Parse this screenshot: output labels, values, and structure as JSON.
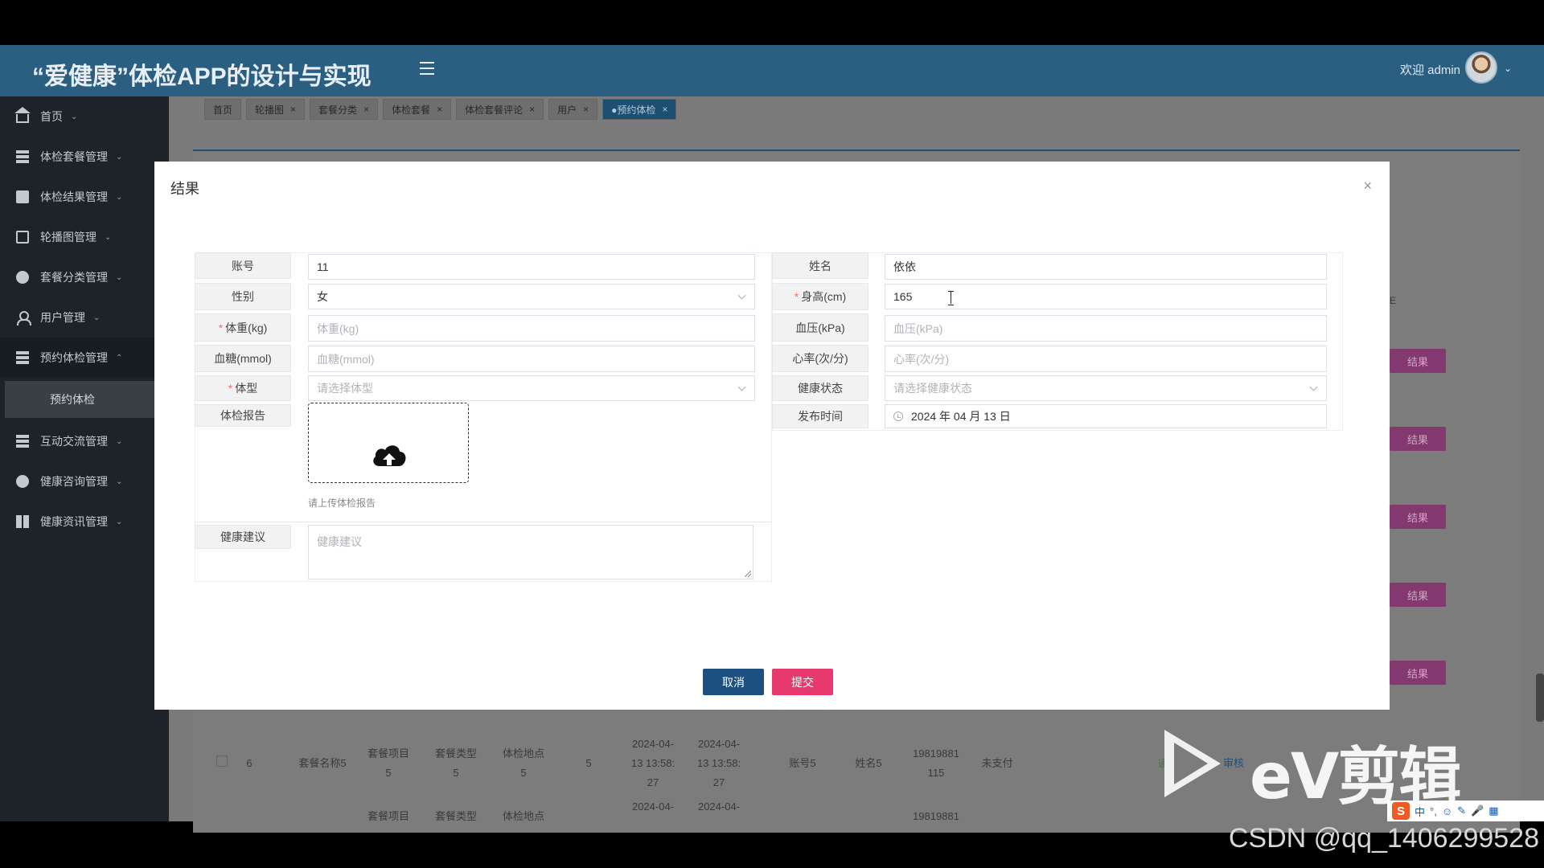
{
  "header": {
    "app_title": "“爱健康”体检APP的设计与实现",
    "welcome": "欢迎 admin"
  },
  "sidebar": {
    "items": [
      {
        "label": "首页",
        "icon": "home-icon"
      },
      {
        "label": "体检套餐管理",
        "icon": "list-icon"
      },
      {
        "label": "体检结果管理",
        "icon": "card-icon"
      },
      {
        "label": "轮播图管理",
        "icon": "document-icon"
      },
      {
        "label": "套餐分类管理",
        "icon": "dot-icon"
      },
      {
        "label": "用户管理",
        "icon": "user-icon"
      },
      {
        "label": "预约体检管理",
        "icon": "list-icon"
      },
      {
        "label": "互动交流管理",
        "icon": "list-icon"
      },
      {
        "label": "健康咨询管理",
        "icon": "dot-icon"
      },
      {
        "label": "健康资讯管理",
        "icon": "grid-icon"
      }
    ],
    "active_sub": "预约体检"
  },
  "tabs": [
    {
      "label": "首页",
      "closable": false
    },
    {
      "label": "轮播图",
      "closable": true
    },
    {
      "label": "套餐分类",
      "closable": true
    },
    {
      "label": "体检套餐",
      "closable": true
    },
    {
      "label": "体检套餐评论",
      "closable": true
    },
    {
      "label": "用户",
      "closable": true
    },
    {
      "label": "●预约体检",
      "closable": true
    }
  ],
  "background_table": {
    "result_button": "结果",
    "header_fragment": "E",
    "rows": [
      [
        "6",
        "套餐名称5",
        "套餐项目\n5",
        "套餐类型\n5",
        "体检地点\n5",
        "5",
        "2024-04-\n13 13:58:\n27",
        "2024-04-\n13 13:58:\n27",
        "账号5",
        "姓名5",
        "19819881\n115",
        "未支付",
        "通过",
        "审核"
      ],
      [
        "",
        "",
        "套餐项目",
        "套餐类型",
        "体检地点",
        "",
        "2024-04-",
        "2024-04-",
        "",
        "",
        "19819881",
        "",
        "",
        ""
      ]
    ]
  },
  "modal": {
    "title": "结果",
    "close": "×",
    "fields": {
      "account": {
        "label": "账号",
        "value": "11"
      },
      "name": {
        "label": "姓名",
        "value": "依依"
      },
      "gender": {
        "label": "性别",
        "value": "女"
      },
      "height": {
        "label": "身高(cm)",
        "value": "165",
        "required": "*"
      },
      "weight": {
        "label": "体重(kg)",
        "placeholder": "体重(kg)",
        "required": "*"
      },
      "blood_pressure": {
        "label": "血压(kPa)",
        "placeholder": "血压(kPa)"
      },
      "blood_sugar": {
        "label": "血糖(mmol)",
        "placeholder": "血糖(mmol)"
      },
      "heart_rate": {
        "label": "心率(次/分)",
        "placeholder": "心率(次/分)"
      },
      "body_type": {
        "label": "体型",
        "placeholder": "请选择体型",
        "required": "*"
      },
      "health_status": {
        "label": "健康状态",
        "placeholder": "请选择健康状态"
      },
      "report": {
        "label": "体检报告",
        "hint": "请上传体检报告"
      },
      "publish_time": {
        "label": "发布时间",
        "value": "2024 年 04 月 13 日"
      },
      "advice": {
        "label": "健康建议",
        "placeholder": "健康建议"
      }
    },
    "buttons": {
      "cancel": "取消",
      "submit": "提交"
    }
  },
  "overlay": {
    "watermark": "eV剪辑",
    "csdn": "CSDN @qq_1406299528",
    "ime": [
      "中",
      "°,",
      "☺",
      "✎",
      "🎤",
      "▦"
    ]
  },
  "colors": {
    "header": "#2a5f82",
    "sidebar": "#1d2329",
    "cancel_button": "#1d4f82",
    "submit_button": "#e8396e",
    "result_button": "#83386f"
  }
}
